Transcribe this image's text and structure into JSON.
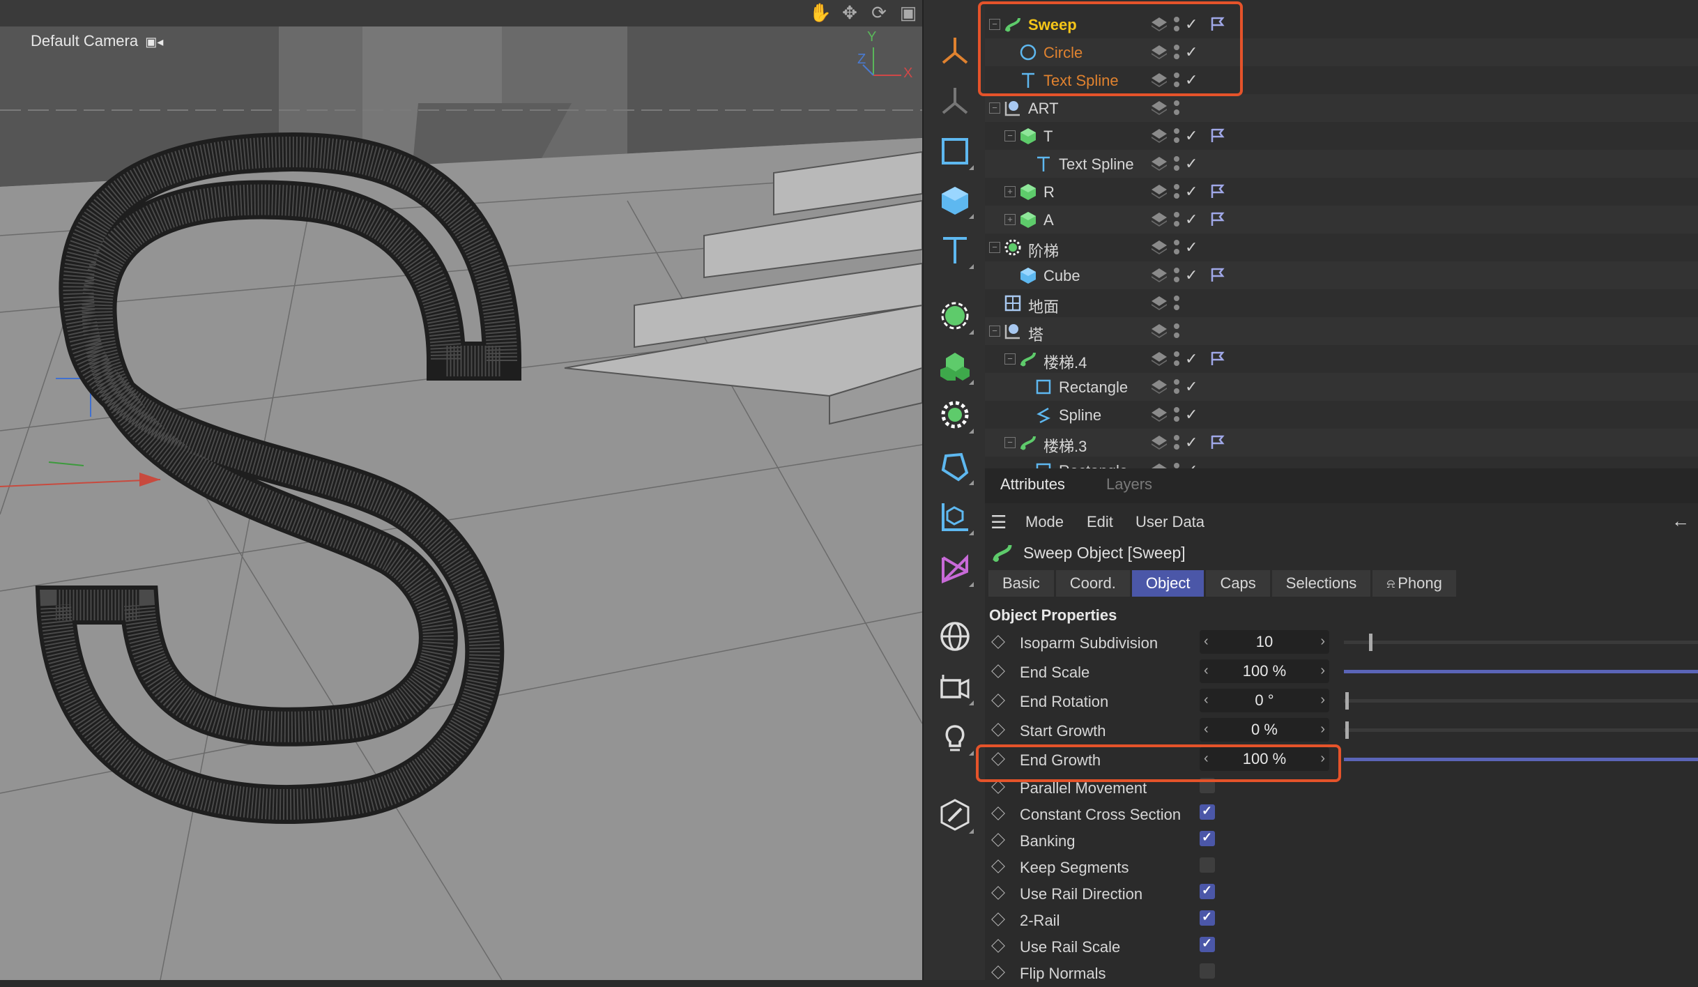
{
  "viewport": {
    "camera_label": "Default Camera",
    "nav_icons": [
      "hand-icon",
      "move-icon",
      "rotate-icon",
      "frame-icon"
    ],
    "axis_labels": {
      "x": "X",
      "y": "Y",
      "z": "Z"
    }
  },
  "toolbar": {
    "tools": [
      "axis-tool-icon",
      "axis-alt-icon",
      "rectangle-spline-icon",
      "cube-icon",
      "text-icon",
      "generator-icon",
      "cloner-icon",
      "deformer-icon",
      "field-icon",
      "coord-icon",
      "spline-tool-icon",
      "scene-icon",
      "camera-icon",
      "light-icon",
      "edit-icon"
    ]
  },
  "object_manager": {
    "rows": [
      {
        "name": "Sweep",
        "icon": "sweep-icon",
        "color": "#f5c518",
        "flag": true
      },
      {
        "name": "Circle",
        "icon": "circle-icon",
        "color": "#e0822f",
        "flag": false
      },
      {
        "name": "Text Spline",
        "icon": "text-spline-icon",
        "color": "#e0822f",
        "flag": false
      },
      {
        "name": "ART",
        "icon": "null-icon",
        "color": "#d7d7d7",
        "flag": false
      },
      {
        "name": "T",
        "icon": "extrude-icon",
        "color": "#d7d7d7",
        "flag": true
      },
      {
        "name": "Text Spline",
        "icon": "text-spline-icon",
        "color": "#d7d7d7",
        "flag": false
      },
      {
        "name": "R",
        "icon": "extrude-icon",
        "color": "#d7d7d7",
        "flag": true
      },
      {
        "name": "A",
        "icon": "extrude-icon",
        "color": "#d7d7d7",
        "flag": true
      },
      {
        "name": "阶梯",
        "icon": "cloner-gear-icon",
        "color": "#d7d7d7",
        "flag": false
      },
      {
        "name": "Cube",
        "icon": "cube-icon",
        "color": "#d7d7d7",
        "flag": true
      },
      {
        "name": "地面",
        "icon": "floor-icon",
        "color": "#d7d7d7",
        "flag": false
      },
      {
        "name": "塔",
        "icon": "null-icon",
        "color": "#d7d7d7",
        "flag": false
      },
      {
        "name": "楼梯.4",
        "icon": "sweep-icon",
        "color": "#d7d7d7",
        "flag": true
      },
      {
        "name": "Rectangle",
        "icon": "rectangle-icon",
        "color": "#d7d7d7",
        "flag": false
      },
      {
        "name": "Spline",
        "icon": "spline-icon",
        "color": "#d7d7d7",
        "flag": false
      },
      {
        "name": "楼梯.3",
        "icon": "sweep-icon",
        "color": "#d7d7d7",
        "flag": true
      },
      {
        "name": "Rectangle",
        "icon": "rectangle-icon",
        "color": "#d7d7d7",
        "flag": false
      }
    ]
  },
  "attributes": {
    "tabs": [
      "Attributes",
      "Layers"
    ],
    "menu": [
      "Mode",
      "Edit",
      "User Data"
    ],
    "object_title": "Sweep Object [Sweep]",
    "prop_tabs": [
      "Basic",
      "Coord.",
      "Object",
      "Caps",
      "Selections",
      "Phong"
    ],
    "active_tab": "Object",
    "section": "Object Properties",
    "numeric": [
      {
        "label": "Isoparm Subdivision",
        "value": "10",
        "level": 0.07,
        "style": "knob"
      },
      {
        "label": "End Scale",
        "value": "100 %",
        "level": 1.0,
        "style": "fill"
      },
      {
        "label": "End Rotation",
        "value": "0 °",
        "level": 0.0,
        "style": "knob"
      },
      {
        "label": "Start Growth",
        "value": "0 %",
        "level": 0.0,
        "style": "knob"
      },
      {
        "label": "End Growth",
        "value": "100 %",
        "level": 1.0,
        "style": "fill"
      }
    ],
    "checks": [
      {
        "label": "Parallel Movement",
        "checked": false
      },
      {
        "label": "Constant Cross Section",
        "checked": true
      },
      {
        "label": "Banking",
        "checked": true
      },
      {
        "label": "Keep Segments",
        "checked": false
      },
      {
        "label": "Use Rail Direction",
        "checked": true
      },
      {
        "label": "2-Rail",
        "checked": true
      },
      {
        "label": "Use Rail Scale",
        "checked": true
      },
      {
        "label": "Flip Normals",
        "checked": false
      }
    ]
  },
  "colors": {
    "accent": "#4b57a8",
    "highlight": "#e5532a"
  }
}
